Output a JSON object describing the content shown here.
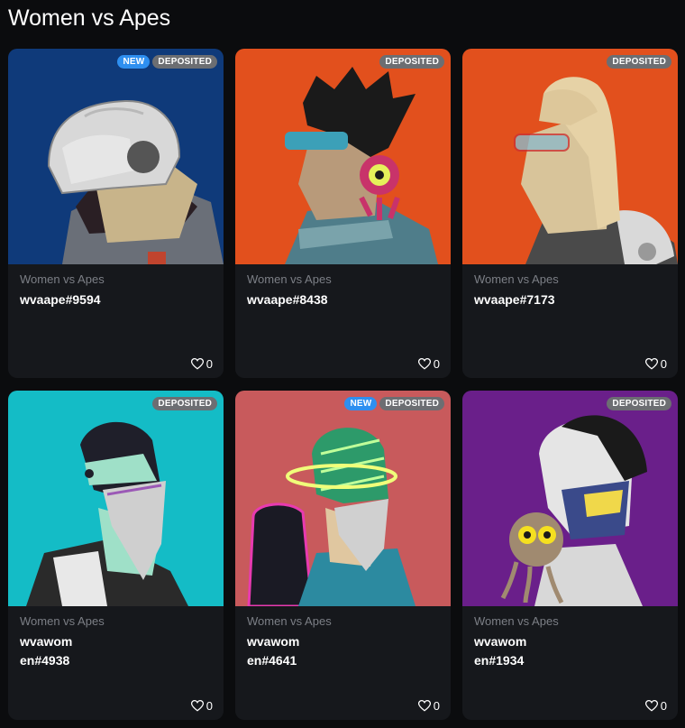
{
  "page": {
    "title": "Women vs Apes"
  },
  "colors": {
    "badge_new": "#2e8ff0",
    "badge_deposited": "#6c6e72",
    "card_bg": "#16181c",
    "page_bg": "#0b0c0e"
  },
  "cards": [
    {
      "collection": "Women vs Apes",
      "name": "wvaape#9594",
      "likes": "0",
      "badges": [
        "NEW",
        "DEPOSITED"
      ],
      "art_bg": "#0f3a7a",
      "art_icon": "ape-astronaut-helmet-image"
    },
    {
      "collection": "Women vs Apes",
      "name": "wvaape#8438",
      "likes": "0",
      "badges": [
        "DEPOSITED"
      ],
      "art_bg": "#e2501d",
      "art_icon": "ape-visor-with-eyeball-pet-image"
    },
    {
      "collection": "Women vs Apes",
      "name": "wvaape#7173",
      "likes": "0",
      "badges": [
        "DEPOSITED"
      ],
      "art_bg": "#e2501d",
      "art_icon": "ape-goggles-blonde-hair-image"
    },
    {
      "collection": "Women vs Apes",
      "name": "wvawomen#4938",
      "likes": "0",
      "badges": [
        "DEPOSITED"
      ],
      "art_bg": "#14bcc6",
      "art_icon": "woman-bandana-mask-image"
    },
    {
      "collection": "Women vs Apes",
      "name": "wvawomen#4641",
      "likes": "0",
      "badges": [
        "NEW",
        "DEPOSITED"
      ],
      "art_bg": "#c85a5c",
      "art_icon": "woman-halo-backpack-image"
    },
    {
      "collection": "Women vs Apes",
      "name": "wvawomen#1934",
      "likes": "0",
      "badges": [
        "DEPOSITED"
      ],
      "art_bg": "#6a1f8a",
      "art_icon": "woman-cyborg-skull-mask-image"
    }
  ]
}
